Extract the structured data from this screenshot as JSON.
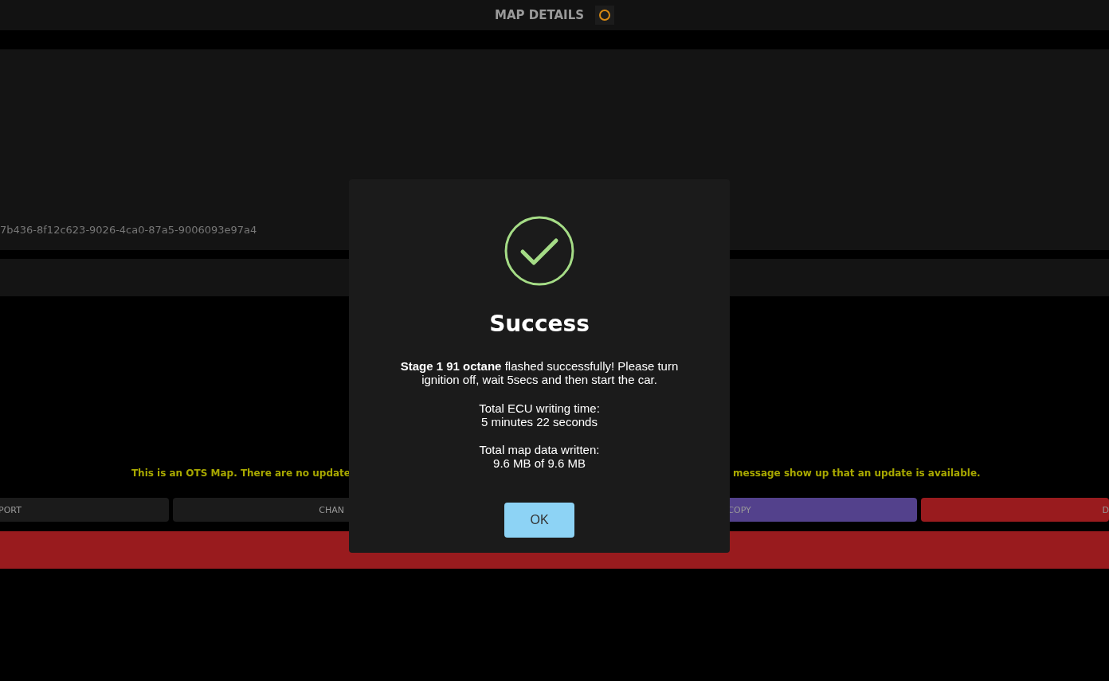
{
  "header": {
    "title": "MAP DETAILS"
  },
  "map_panel": {
    "map_id": "7b436-8f12c623-9026-4ca0-87a5-9006093e97a4"
  },
  "notice": {
    "left_part": "This is an OTS Map. There are no update",
    "right_part": "message show up that an update is available."
  },
  "actions": [
    {
      "label": "PORT",
      "kind": "plain"
    },
    {
      "label": "CHAN",
      "kind": "plain"
    },
    {
      "label": "COPY",
      "kind": "accent"
    },
    {
      "label": "D",
      "kind": "danger"
    }
  ],
  "dialog": {
    "title": "Success",
    "message": "**Stage 1 91 octane** flashed successfully! Please turn ignition off, wait 5secs and then start the car.",
    "details": [
      [
        "Total ECU writing time:",
        "5 minutes 22 seconds"
      ],
      [
        "Total map data written:",
        "9.6 MB of 9.6 MB"
      ]
    ],
    "button": "OK"
  }
}
